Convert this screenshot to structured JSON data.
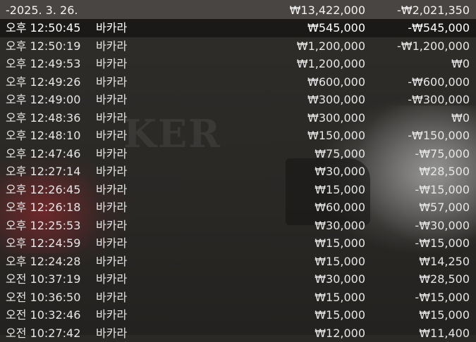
{
  "summary": {
    "date": "-2025. 3. 26.",
    "total_bet": "₩13,422,000",
    "total_result": "-₩2,021,350"
  },
  "transactions": [
    {
      "time": "오후 12:50:45",
      "game": "바카라",
      "bet": "₩545,000",
      "result": "-₩545,000"
    },
    {
      "time": "오후 12:50:19",
      "game": "바카라",
      "bet": "₩1,200,000",
      "result": "-₩1,200,000"
    },
    {
      "time": "오후 12:49:53",
      "game": "바카라",
      "bet": "₩1,200,000",
      "result": "₩0"
    },
    {
      "time": "오후 12:49:26",
      "game": "바카라",
      "bet": "₩600,000",
      "result": "-₩600,000"
    },
    {
      "time": "오후 12:49:00",
      "game": "바카라",
      "bet": "₩300,000",
      "result": "-₩300,000"
    },
    {
      "time": "오후 12:48:36",
      "game": "바카라",
      "bet": "₩300,000",
      "result": "₩0"
    },
    {
      "time": "오후 12:48:10",
      "game": "바카라",
      "bet": "₩150,000",
      "result": "-₩150,000"
    },
    {
      "time": "오후 12:47:46",
      "game": "바카라",
      "bet": "₩75,000",
      "result": "-₩75,000"
    },
    {
      "time": "오후 12:27:14",
      "game": "바카라",
      "bet": "₩30,000",
      "result": "₩28,500"
    },
    {
      "time": "오후 12:26:45",
      "game": "바카라",
      "bet": "₩15,000",
      "result": "-₩15,000"
    },
    {
      "time": "오후 12:26:18",
      "game": "바카라",
      "bet": "₩60,000",
      "result": "₩57,000"
    },
    {
      "time": "오후 12:25:53",
      "game": "바카라",
      "bet": "₩30,000",
      "result": "-₩30,000"
    },
    {
      "time": "오후 12:24:59",
      "game": "바카라",
      "bet": "₩15,000",
      "result": "-₩15,000"
    },
    {
      "time": "오후 12:24:28",
      "game": "바카라",
      "bet": "₩15,000",
      "result": "₩14,250"
    },
    {
      "time": "오전 10:37:19",
      "game": "바카라",
      "bet": "₩30,000",
      "result": "₩28,500"
    },
    {
      "time": "오전 10:36:50",
      "game": "바카라",
      "bet": "₩15,000",
      "result": "-₩15,000"
    },
    {
      "time": "오전 10:32:46",
      "game": "바카라",
      "bet": "₩15,000",
      "result": "₩15,000"
    },
    {
      "time": "오전 10:27:42",
      "game": "바카라",
      "bet": "₩12,000",
      "result": "₩11,400"
    }
  ],
  "background": {
    "watermark_text": "KER"
  },
  "colors": {
    "header_bg": "#4b4844",
    "highlight_bg": "#191816",
    "text": "#e6e6e6"
  }
}
